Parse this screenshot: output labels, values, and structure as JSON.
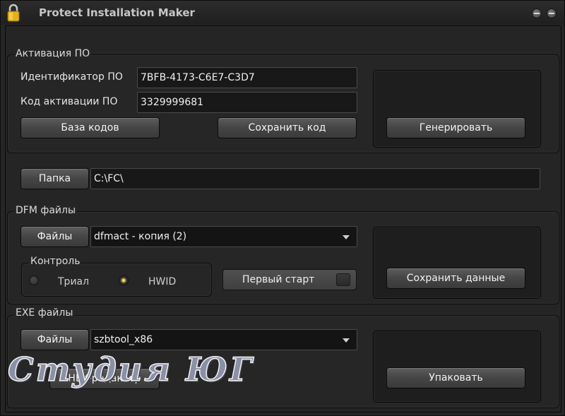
{
  "window": {
    "title": "Protect Installation Maker"
  },
  "activation": {
    "legend": "Активация ПО",
    "id_label": "Идентификатор ПО",
    "id_value": "7BFB-4173-C6E7-C3D7",
    "code_label": "Код активации ПО",
    "code_value": "3329999681",
    "codes_db_button": "База кодов",
    "save_code_button": "Сохранить код",
    "generate_button": "Генерировать"
  },
  "folder": {
    "button": "Папка",
    "path": "C:\\FC\\"
  },
  "dfm": {
    "legend": "DFM файлы",
    "files_button": "Файлы",
    "selected_file": "dfmact - копия (2)",
    "control_legend": "Контроль",
    "radio_trial": "Триал",
    "radio_hwid": "HWID",
    "selected_control": "HWID",
    "first_start_label": "Первый старт",
    "first_start_checked": false,
    "save_data_button": "Сохранить данные"
  },
  "exe": {
    "legend": "EXE файлы",
    "files_button": "Файлы",
    "selected_file": "szbtool_x86",
    "hex_editor_button": "HEX-редактор",
    "pack_button": "Упаковать"
  },
  "watermark": {
    "text": "Студия ЮГ"
  },
  "colors": {
    "window_bg": "#262626",
    "field_bg": "#181818",
    "radio_selected": "#e8c040",
    "lock_icon": "#e6b21c"
  }
}
